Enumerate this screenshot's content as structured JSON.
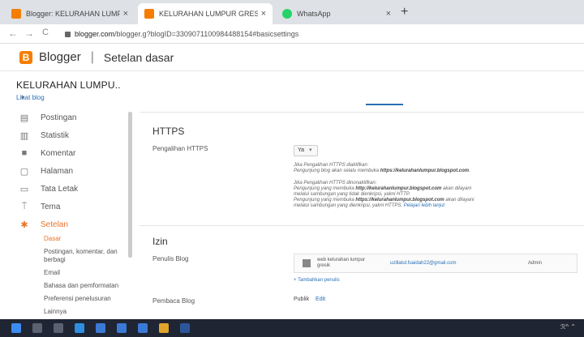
{
  "browser": {
    "tabs": [
      {
        "title": "Blogger: KELURAHAN LUMPUR",
        "active": false,
        "favicon_color": "#f57d00"
      },
      {
        "title": "KELURAHAN LUMPUR GRESIK",
        "active": true,
        "favicon_color": "#f57d00"
      },
      {
        "title": "WhatsApp",
        "active": false,
        "favicon_color": "#25d366"
      }
    ],
    "close_glyph": "×",
    "new_tab_glyph": "+",
    "back_glyph": "←",
    "forward_glyph": "→",
    "reload_glyph": "C",
    "url_host": "blogger.com",
    "url_path": "/blogger.g?blogID=3309071100984488154#basicsettings"
  },
  "header": {
    "logo_letter": "B",
    "app_name": "Blogger",
    "separator": "|",
    "page_title": "Setelan dasar",
    "brand_color": "#f57d00"
  },
  "sidebar": {
    "blog_title": "KELURAHAN LUMPU..",
    "dropdown_glyph": "▾",
    "view_blog": "Lihat blog",
    "items": [
      {
        "label": "Postingan",
        "icon": "posts-icon",
        "glyph": "▤"
      },
      {
        "label": "Statistik",
        "icon": "stats-icon",
        "glyph": "▥"
      },
      {
        "label": "Komentar",
        "icon": "comments-icon",
        "glyph": "■"
      },
      {
        "label": "Halaman",
        "icon": "pages-icon",
        "glyph": "▢"
      },
      {
        "label": "Tata Letak",
        "icon": "layout-icon",
        "glyph": "▭"
      },
      {
        "label": "Tema",
        "icon": "theme-icon",
        "glyph": "⍑"
      },
      {
        "label": "Setelan",
        "icon": "settings-gear-icon",
        "glyph": "✱",
        "selected": true
      }
    ],
    "subitems": [
      {
        "label": "Dasar",
        "selected": true
      },
      {
        "label": "Postingan, komentar, dan berbagi"
      },
      {
        "label": "Email"
      },
      {
        "label": "Bahasa dan pemformatan"
      },
      {
        "label": "Preferensi penelusuran"
      },
      {
        "label": "Lainnya"
      }
    ]
  },
  "https": {
    "heading": "HTTPS",
    "redirect_label": "Pengalihan HTTPS",
    "redirect_value": "Ya",
    "select_arrow": "▾",
    "hint1_line1": "Jika Pengalihan HTTPS diaktifkan:",
    "hint1_line2_pre": "Pengunjung blog akan selalu membuka ",
    "hint1_line2_url": "https://kelurahanlumpur.blogspot.com",
    "hint1_line2_post": ".",
    "hint2_line1": "Jika Pengalihan HTTPS dinonaktifkan:",
    "hint2_line2_pre": "Pengunjung yang membuka ",
    "hint2_line2_url": "http://kelurahanlumpur.blogspot.com",
    "hint2_line2_post": " akan dilayani",
    "hint2_line3": "melalui sambungan yang tidak dienkripsi, yakni HTTP.",
    "hint2_line4_pre": "Pengunjung yang membuka ",
    "hint2_line4_url": "https://kelurahanlumpur.blogspot.com",
    "hint2_line4_post": " akan dilayani",
    "hint2_line5": "melalui sambungan yang dienkripsi, yakni HTTPS.",
    "learn_more": "Pelajari lebih lanjut"
  },
  "permissions": {
    "heading": "Izin",
    "authors_label": "Penulis Blog",
    "author_name": "web kelurahan lumpur gresik",
    "author_email": "uzillatul.fuaidah22@gmail.com",
    "author_role": "Admin",
    "add_author": "+ Tambahkan penulis",
    "readers_label": "Pembaca Blog",
    "readers_value": "Publik",
    "edit": "Edit"
  },
  "taskbar": {
    "icons": [
      {
        "name": "windows-start-icon",
        "color": "#3d8cf0"
      },
      {
        "name": "search-icon",
        "color": "#5a6170"
      },
      {
        "name": "task-view-icon",
        "color": "#5a6170"
      },
      {
        "name": "edge-browser-icon",
        "color": "#2f8ee0"
      },
      {
        "name": "store-icon",
        "color": "#3b79d6"
      },
      {
        "name": "mail-icon",
        "color": "#3b79d6"
      },
      {
        "name": "pinned-app-icon",
        "color": "#3b79d6"
      },
      {
        "name": "chrome-icon",
        "color": "#e0a52a"
      },
      {
        "name": "word-icon",
        "color": "#2b579a"
      }
    ],
    "tray": "ℛ^ ⌃"
  }
}
